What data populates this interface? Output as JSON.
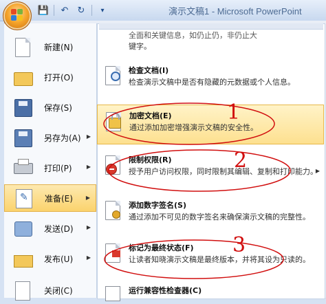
{
  "window": {
    "title": "演示文稿1 - Microsoft PowerPoint"
  },
  "quick_access": {
    "save_icon": "save-icon",
    "undo_icon": "undo-icon",
    "redo_icon": "redo-icon",
    "customize_icon": "customize-qat-icon"
  },
  "left_menu": {
    "items": [
      {
        "label": "新建(N)",
        "icon": "new-document-icon"
      },
      {
        "label": "打开(O)",
        "icon": "open-folder-icon"
      },
      {
        "label": "保存(S)",
        "icon": "save-disk-icon"
      },
      {
        "label": "另存为(A)",
        "icon": "save-as-icon",
        "has_submenu": true
      },
      {
        "label": "打印(P)",
        "icon": "printer-icon",
        "has_submenu": true
      },
      {
        "label": "准备(E)",
        "icon": "prepare-icon",
        "has_submenu": true,
        "selected": true
      },
      {
        "label": "发送(D)",
        "icon": "send-icon",
        "has_submenu": true
      },
      {
        "label": "发布(U)",
        "icon": "publish-icon",
        "has_submenu": true
      },
      {
        "label": "关闭(C)",
        "icon": "close-document-icon"
      }
    ]
  },
  "right_menu": {
    "partial_top_text": {
      "line1": "全面和关键信息，如仍止仍，非仍止大",
      "line2": "键字。"
    },
    "items": [
      {
        "title": "检查文档(I)",
        "desc": "检查演示文稿中是否有隐藏的元数据或个人信息。",
        "icon": "inspect-document-icon"
      },
      {
        "title": "加密文档(E)",
        "desc": "通过添加加密增强演示文稿的安全性。",
        "icon": "encrypt-lock-icon",
        "highlighted": true
      },
      {
        "title": "限制权限(R)",
        "desc": "授予用户访问权限，同时限制其编辑、复制和打印能力。",
        "icon": "restrict-permission-icon",
        "has_submenu": true
      },
      {
        "title": "添加数字签名(S)",
        "desc": "通过添加不可见的数字签名来确保演示文稿的完整性。",
        "icon": "digital-signature-icon"
      },
      {
        "title": "标记为最终状态(F)",
        "desc": "让读者知晓演示文稿是最终版本，并将其设为只读的。",
        "icon": "mark-final-icon"
      },
      {
        "title": "运行兼容性检查器(C)",
        "desc": "",
        "icon": "compatibility-checker-icon"
      }
    ]
  },
  "annotations": {
    "numbers": [
      "1",
      "2",
      "3"
    ],
    "color": "#d10e0e"
  },
  "colors": {
    "highlight": "#fde08f",
    "accent": "#1f4f8f"
  }
}
